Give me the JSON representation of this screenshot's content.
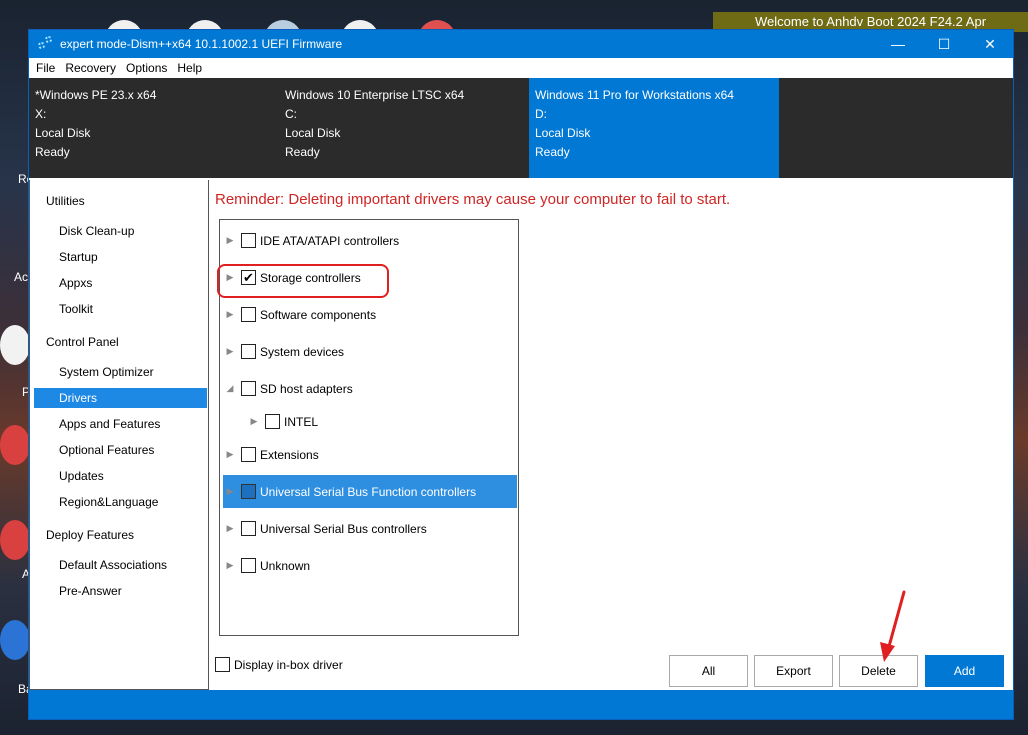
{
  "desktop": {
    "banner": "Welcome to Anhdv Boot 2024 F24.2 Apr",
    "left_labels": [
      "Re",
      "Ac",
      "P",
      "A",
      "Ba"
    ]
  },
  "window": {
    "title": "expert mode-Dism++x64 10.1.1002.1 UEFI Firmware",
    "controls": {
      "minimize": "—",
      "maximize": "☐",
      "close": "✕"
    }
  },
  "menu": [
    "File",
    "Recovery",
    "Options",
    "Help"
  ],
  "disks": [
    {
      "name": "*Windows PE 23.x x64",
      "drive": "X:",
      "type": "Local Disk",
      "status": "Ready"
    },
    {
      "name": "Windows 10 Enterprise LTSC x64",
      "drive": "C:",
      "type": "Local Disk",
      "status": "Ready"
    },
    {
      "name": "Windows 11 Pro for Workstations x64",
      "drive": "D:",
      "type": "Local Disk",
      "status": "Ready"
    }
  ],
  "sidebar": {
    "utilities_header": "Utilities",
    "utilities": [
      "Disk Clean-up",
      "Startup",
      "Appxs",
      "Toolkit"
    ],
    "control_panel_header": "Control Panel",
    "control_panel": [
      "System Optimizer",
      "Drivers",
      "Apps and Features",
      "Optional Features",
      "Updates",
      "Region&Language"
    ],
    "deploy_header": "Deploy Features",
    "deploy": [
      "Default Associations",
      "Pre-Answer"
    ],
    "active": "Drivers"
  },
  "main": {
    "reminder": "Reminder: Deleting important drivers may cause your computer to fail to start.",
    "tree": [
      {
        "label": "IDE ATA/ATAPI controllers",
        "checked": false
      },
      {
        "label": "Storage controllers",
        "checked": true
      },
      {
        "label": "Software components",
        "checked": false
      },
      {
        "label": "System devices",
        "checked": false
      },
      {
        "label": "SD host adapters",
        "checked": false
      },
      {
        "label": "INTEL",
        "checked": false
      },
      {
        "label": "Extensions",
        "checked": false
      },
      {
        "label": "Universal Serial Bus Function controllers",
        "checked": false,
        "highlighted": true
      },
      {
        "label": "Universal Serial Bus controllers",
        "checked": false
      },
      {
        "label": "Unknown",
        "checked": false
      }
    ],
    "inbox_label": "Display in-box driver",
    "check_mark": "✔",
    "buttons": {
      "all": "All",
      "export": "Export",
      "delete": "Delete",
      "add": "Add"
    }
  },
  "colors": {
    "accent": "#0178d4",
    "warning": "#d02525",
    "annotation": "#e02020"
  }
}
